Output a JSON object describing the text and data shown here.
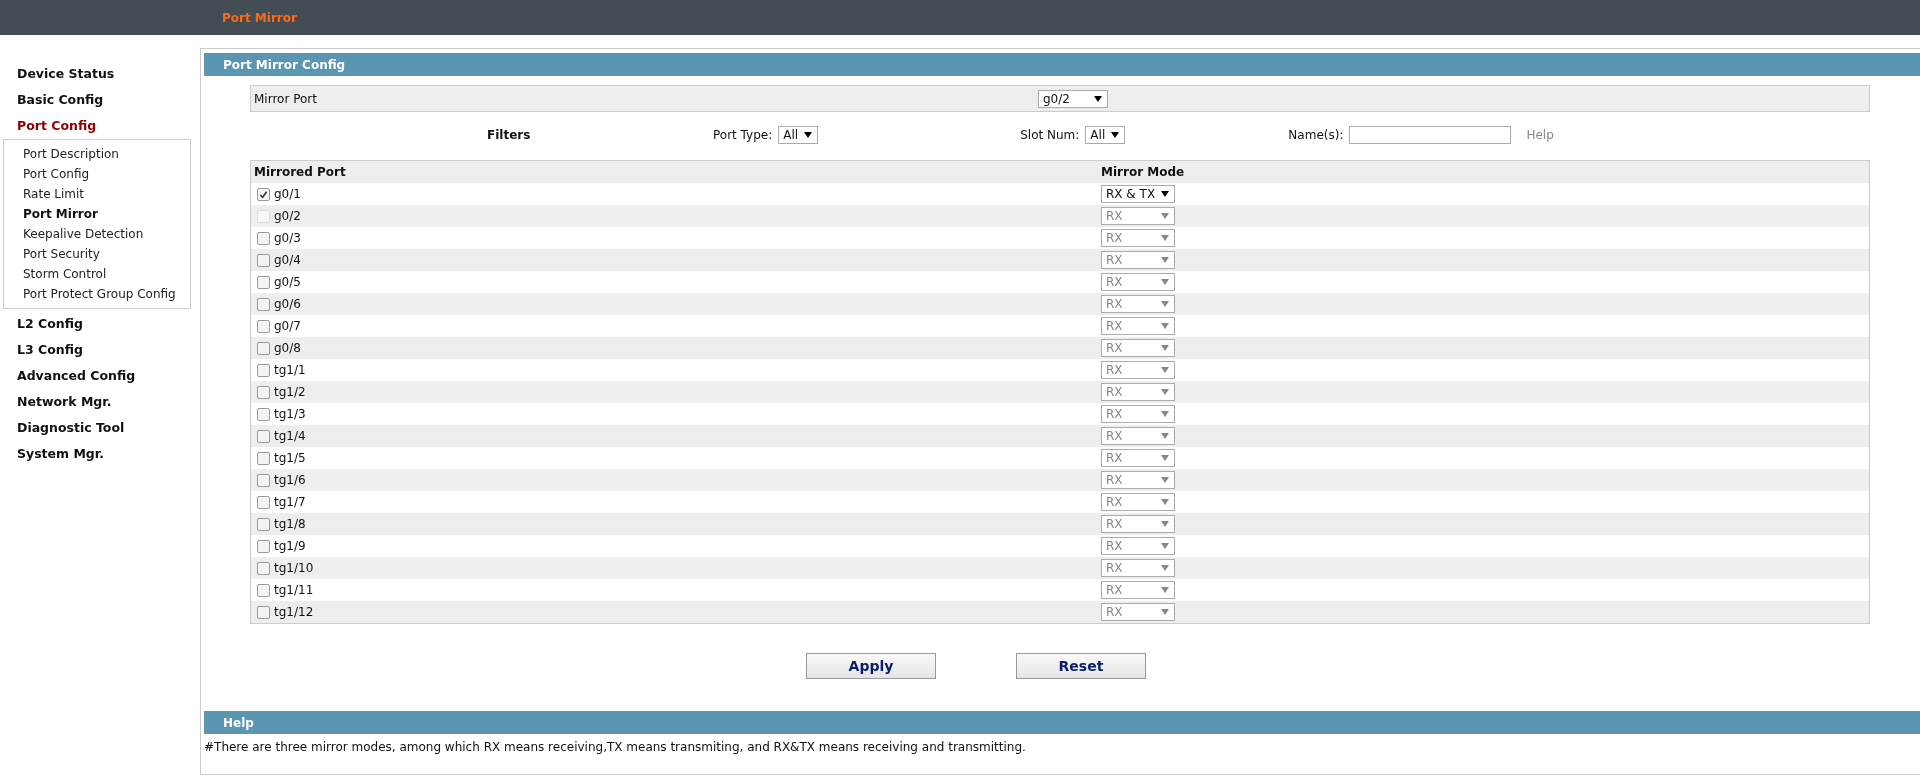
{
  "header": {
    "title": "Port Mirror"
  },
  "sidebar": {
    "items": [
      {
        "label": "Device Status",
        "selected": false
      },
      {
        "label": "Basic Config",
        "selected": false
      },
      {
        "label": "Port Config",
        "selected": true,
        "expanded": true,
        "children": [
          {
            "label": "Port Description",
            "selected": false
          },
          {
            "label": "Port Config",
            "selected": false
          },
          {
            "label": "Rate Limit",
            "selected": false
          },
          {
            "label": "Port Mirror",
            "selected": true
          },
          {
            "label": "Keepalive Detection",
            "selected": false
          },
          {
            "label": "Port Security",
            "selected": false
          },
          {
            "label": "Storm Control",
            "selected": false
          },
          {
            "label": "Port Protect Group Config",
            "selected": false
          }
        ]
      },
      {
        "label": "L2 Config",
        "selected": false
      },
      {
        "label": "L3 Config",
        "selected": false
      },
      {
        "label": "Advanced Config",
        "selected": false
      },
      {
        "label": "Network Mgr.",
        "selected": false
      },
      {
        "label": "Diagnostic Tool",
        "selected": false
      },
      {
        "label": "System Mgr.",
        "selected": false
      }
    ]
  },
  "config": {
    "title": "Port Mirror Config",
    "mirror_port": {
      "label": "Mirror Port",
      "value": "g0/2"
    },
    "filters": {
      "label": "Filters",
      "port_type": {
        "label": "Port Type:",
        "value": "All"
      },
      "slot_num": {
        "label": "Slot Num:",
        "value": "All"
      },
      "names": {
        "label": "Name(s):"
      },
      "help": "Help"
    },
    "table": {
      "columns": [
        "Mirrored Port",
        "Mirror Mode"
      ],
      "rows": [
        {
          "port": "g0/1",
          "checked": true,
          "disabled": false,
          "mode": "RX & TX"
        },
        {
          "port": "g0/2",
          "checked": false,
          "disabled": true,
          "mode": "RX"
        },
        {
          "port": "g0/3",
          "checked": false,
          "disabled": false,
          "mode": "RX"
        },
        {
          "port": "g0/4",
          "checked": false,
          "disabled": false,
          "mode": "RX"
        },
        {
          "port": "g0/5",
          "checked": false,
          "disabled": false,
          "mode": "RX"
        },
        {
          "port": "g0/6",
          "checked": false,
          "disabled": false,
          "mode": "RX"
        },
        {
          "port": "g0/7",
          "checked": false,
          "disabled": false,
          "mode": "RX"
        },
        {
          "port": "g0/8",
          "checked": false,
          "disabled": false,
          "mode": "RX"
        },
        {
          "port": "tg1/1",
          "checked": false,
          "disabled": false,
          "mode": "RX"
        },
        {
          "port": "tg1/2",
          "checked": false,
          "disabled": false,
          "mode": "RX"
        },
        {
          "port": "tg1/3",
          "checked": false,
          "disabled": false,
          "mode": "RX"
        },
        {
          "port": "tg1/4",
          "checked": false,
          "disabled": false,
          "mode": "RX"
        },
        {
          "port": "tg1/5",
          "checked": false,
          "disabled": false,
          "mode": "RX"
        },
        {
          "port": "tg1/6",
          "checked": false,
          "disabled": false,
          "mode": "RX"
        },
        {
          "port": "tg1/7",
          "checked": false,
          "disabled": false,
          "mode": "RX"
        },
        {
          "port": "tg1/8",
          "checked": false,
          "disabled": false,
          "mode": "RX"
        },
        {
          "port": "tg1/9",
          "checked": false,
          "disabled": false,
          "mode": "RX"
        },
        {
          "port": "tg1/10",
          "checked": false,
          "disabled": false,
          "mode": "RX"
        },
        {
          "port": "tg1/11",
          "checked": false,
          "disabled": false,
          "mode": "RX"
        },
        {
          "port": "tg1/12",
          "checked": false,
          "disabled": false,
          "mode": "RX"
        }
      ]
    },
    "buttons": [
      "Apply",
      "Reset"
    ]
  },
  "help": {
    "title": "Help",
    "text": "#There are three mirror modes, among which RX means receiving,TX means transmiting, and RX&TX means receiving and transmitting."
  }
}
